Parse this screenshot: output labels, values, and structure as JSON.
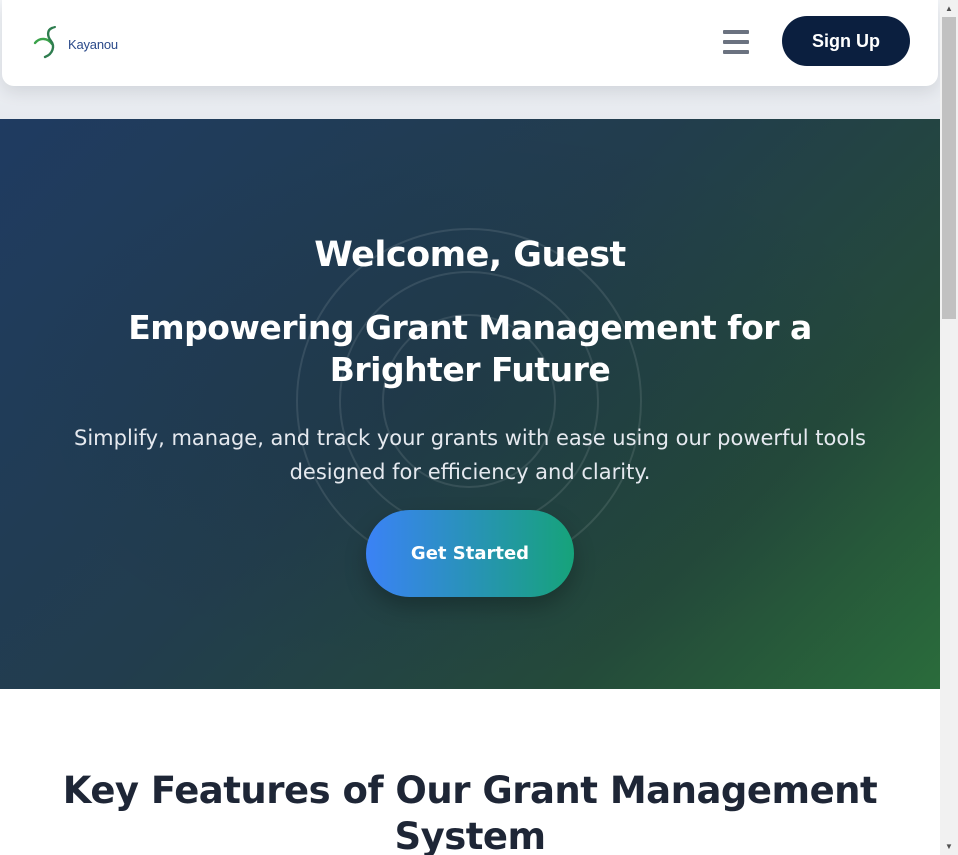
{
  "navbar": {
    "logo_text": "Kayanou",
    "menu_icon": "hamburger-menu-icon",
    "signup_label": "Sign Up"
  },
  "hero": {
    "welcome": "Welcome, Guest",
    "tagline": "Empowering Grant Management for a Brighter Future",
    "description": "Simplify, manage, and track your grants with ease using our powerful tools designed for efficiency and clarity.",
    "cta_label": "Get Started"
  },
  "features": {
    "title": "Key Features of Our Grant Management System"
  },
  "colors": {
    "brand_navy": "#0b1f3f",
    "hero_start": "#1f3b61",
    "hero_end": "#2a6c3b",
    "cta_start": "#3b82f6",
    "cta_end": "#16a37a",
    "heading_text": "#1e2636"
  }
}
